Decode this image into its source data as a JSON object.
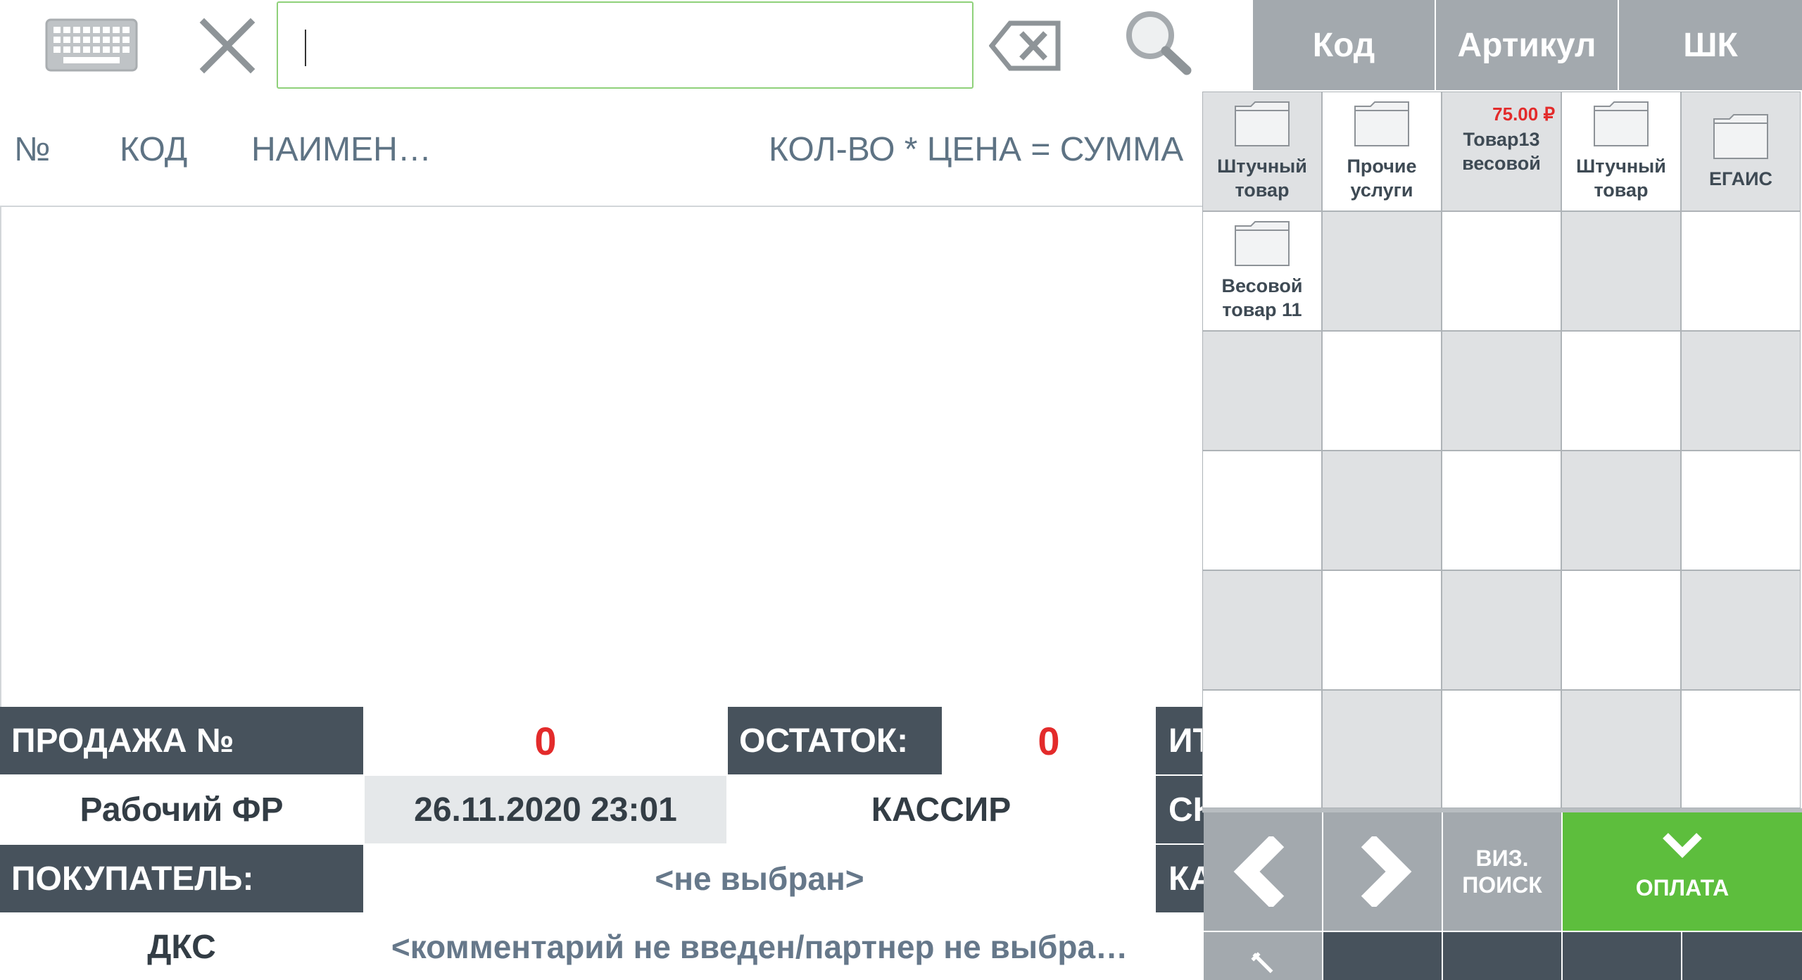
{
  "toolbar": {
    "keyboard_icon": "keyboard-icon",
    "clear_icon": "close-icon",
    "search_value": "",
    "backspace_icon": "backspace-icon",
    "search_icon": "search-icon"
  },
  "columns": {
    "num": "№",
    "code": "КОД",
    "name": "НАИМЕН…",
    "qty_price_sum": "КОЛ-ВО * ЦЕНА = СУММА"
  },
  "info": {
    "sale_label": "ПРОДАЖА №",
    "sale_value": "0",
    "balance_label": "ОСТАТОК:",
    "balance_value": "0",
    "total_label_partial": "ИТ",
    "fr_label": "Рабочий ФР",
    "datetime": "26.11.2020 23:01",
    "cashier": "КАССИР",
    "discount_label_partial": "СК",
    "buyer_label": "ПОКУПАТЕЛЬ:",
    "buyer_value": "<не выбран>",
    "card_label_partial": "КА",
    "dks_label": "ДКС",
    "comment": "<комментарий не введен/партнер не выбра…"
  },
  "search_modes": [
    "Код",
    "Артикул",
    "ШК"
  ],
  "grid": {
    "items": [
      {
        "label1": "Штучный",
        "label2": "товар",
        "type": "folder"
      },
      {
        "label1": "Прочие",
        "label2": "услуги",
        "type": "folder"
      },
      {
        "price": "75.00 ₽",
        "label1": "Товар13",
        "label2": "весовой",
        "type": "product"
      },
      {
        "label1": "Штучный",
        "label2": "товар",
        "type": "folder"
      },
      {
        "label1": "ЕГАИС",
        "label2": "",
        "type": "folder"
      },
      {
        "label1": "Весовой",
        "label2": "товар 11",
        "type": "folder"
      }
    ]
  },
  "nav": {
    "prev_icon": "chevron-left-icon",
    "next_icon": "chevron-right-icon",
    "visual_search_line1": "ВИЗ.",
    "visual_search_line2": "ПОИСК",
    "pay_label": "ОПЛАТА",
    "pay_icon": "chevron-down-icon",
    "settings_icon": "wrench-icon"
  },
  "colors": {
    "accent_green": "#5dbe3d",
    "dark_header": "#47525c",
    "mode_button": "#a3a9ae",
    "alert_red": "#e32b2b"
  }
}
